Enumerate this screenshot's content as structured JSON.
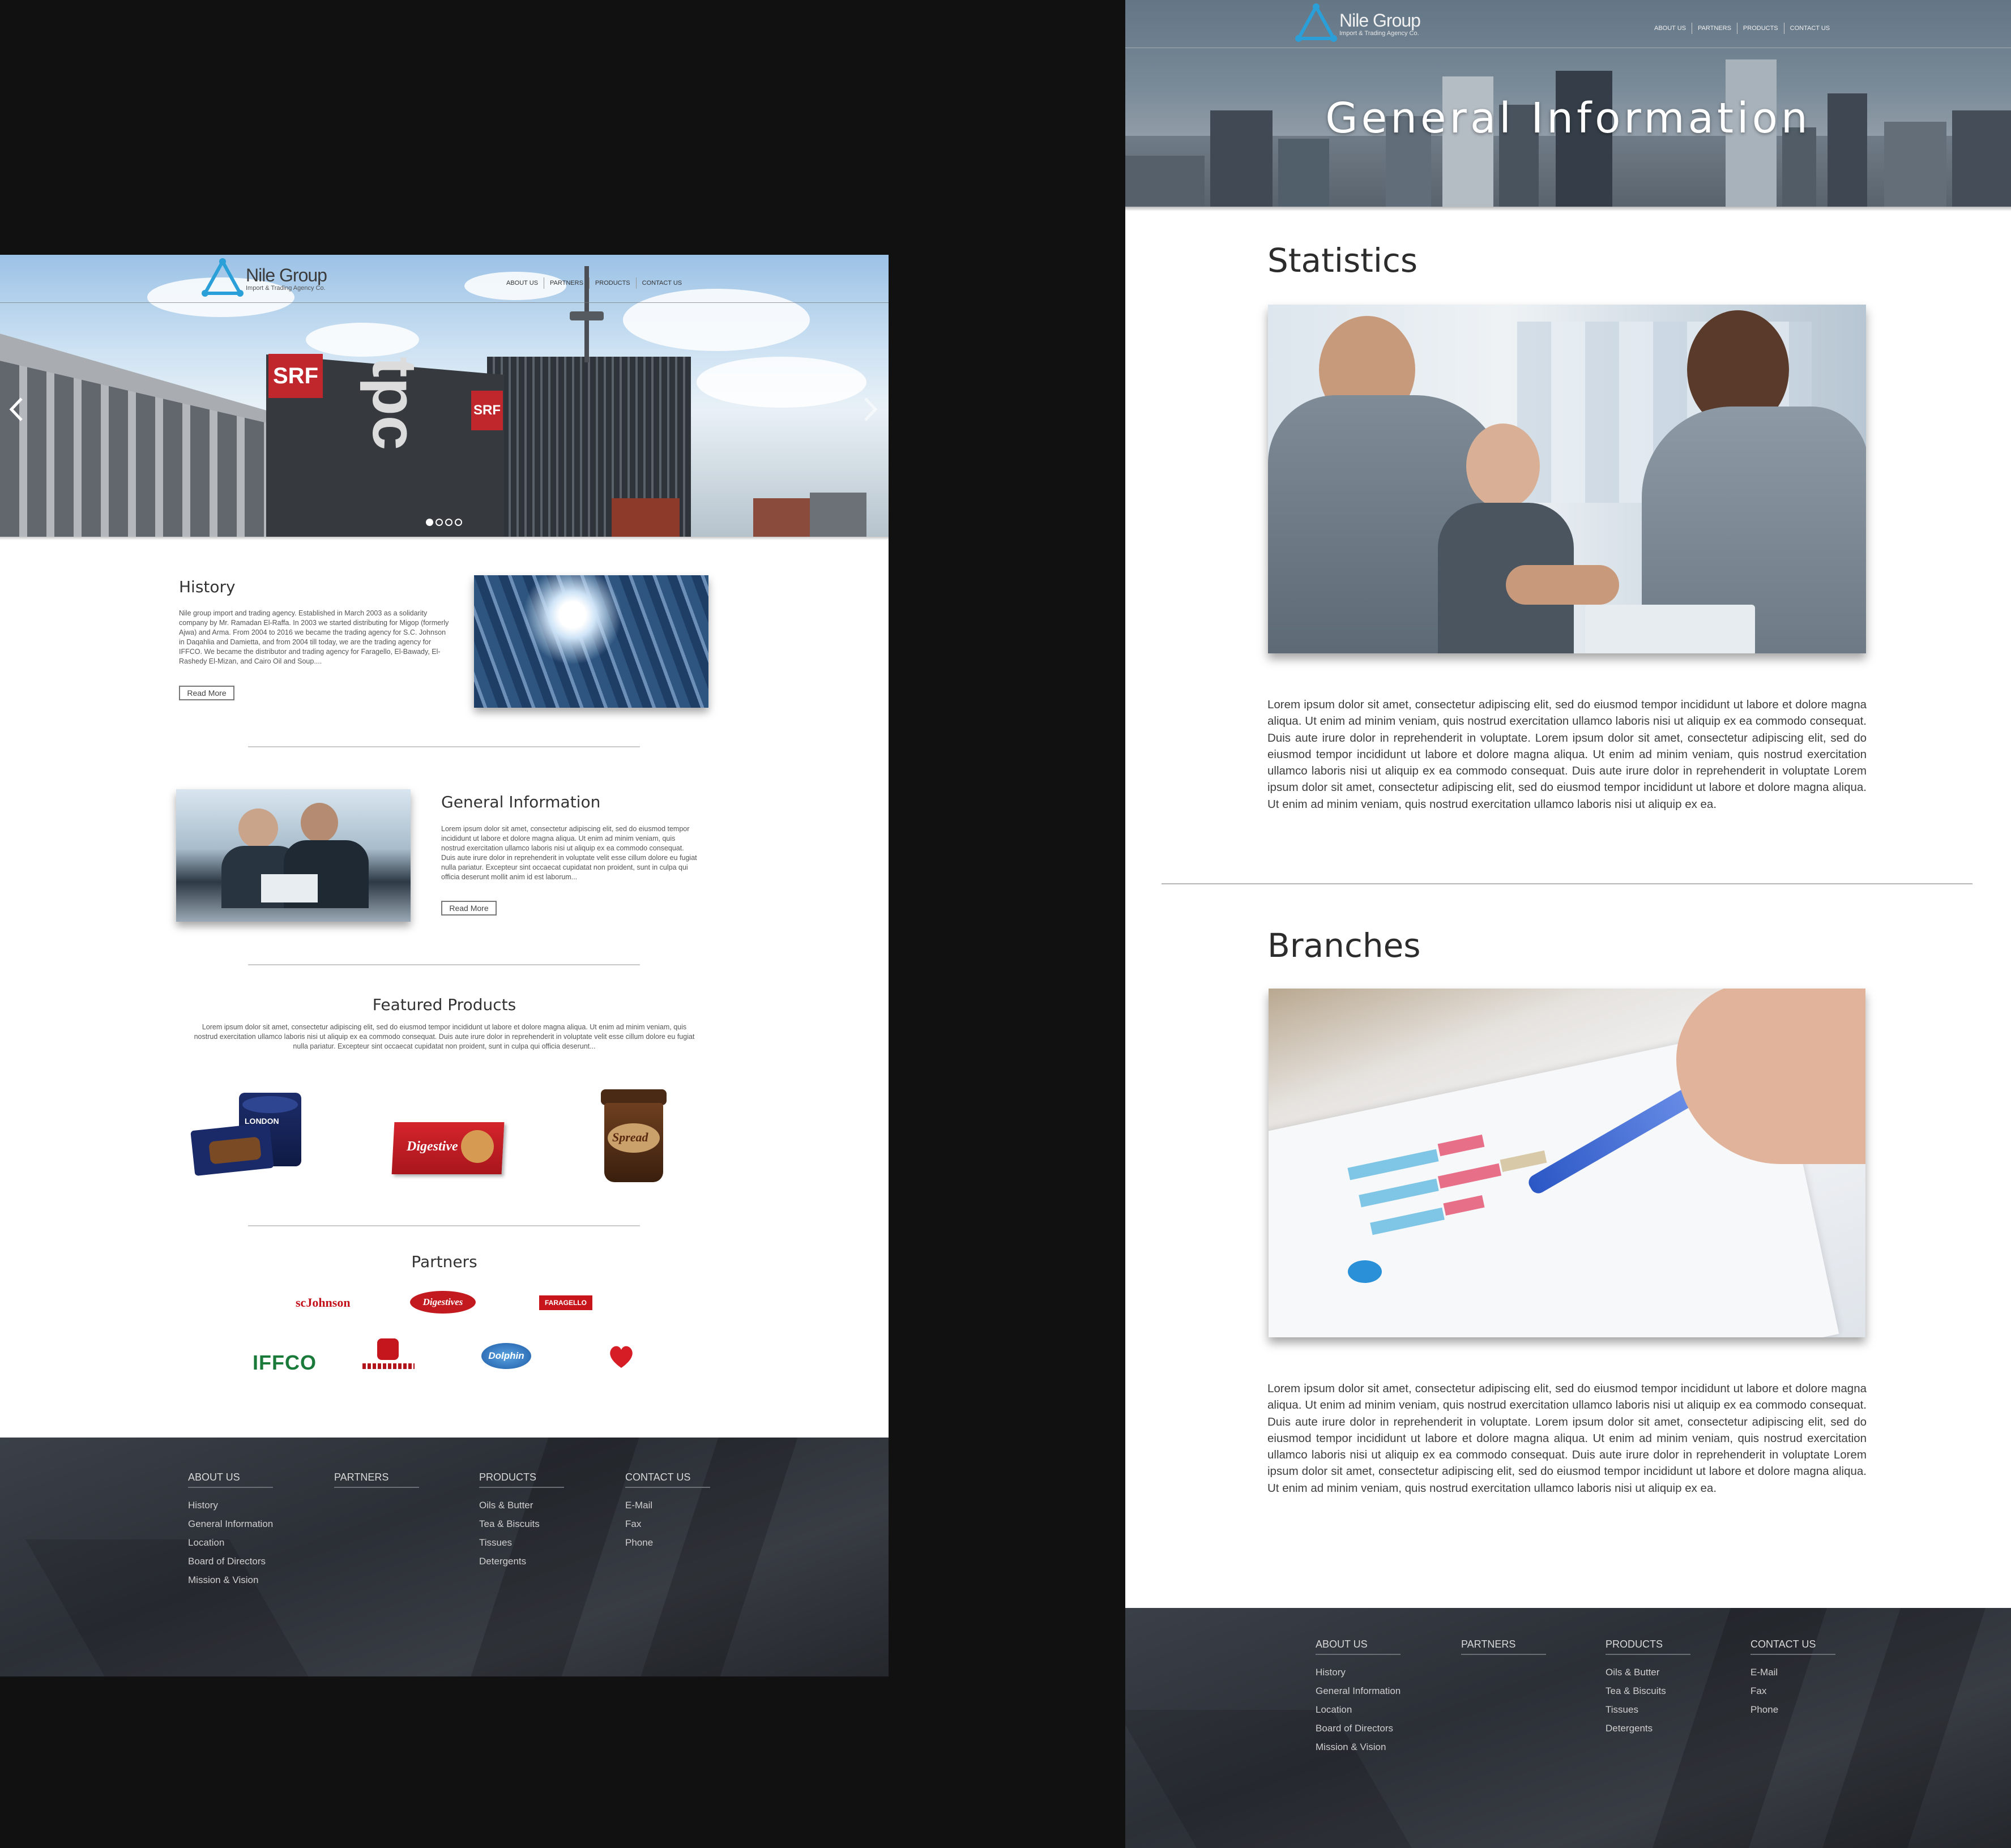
{
  "left_page": {
    "logo": {
      "title": "Nile Group",
      "subtitle": "Import & Trading Agency Co."
    },
    "nav": [
      "ABOUT US",
      "PARTNERS",
      "PRODUCTS",
      "CONTACT US"
    ],
    "hero_sign_srf": "SRF",
    "hero_sign_tpc": "tpc",
    "history": {
      "title": "History",
      "text": "Nile group import and trading agency. Established in March 2003 as a solidarity company by Mr. Ramadan El-Raffa. In 2003 we started distributing for Migop (formerly Ajwa) and Arma. From 2004 to 2016 we became the trading agency for S.C. Johnson in Daqahlia and Damietta, and from 2004 till today, we are the trading agency for IFFCO. We became the distributor and trading agency for Faragello, El-Bawady, El-Rashedy El-Mizan, and Cairo Oil and Soup....",
      "button": "Read More"
    },
    "general": {
      "title": "General Information",
      "text": "Lorem ipsum dolor sit amet, consectetur adipiscing elit, sed do eiusmod tempor incididunt ut labore et dolore magna aliqua. Ut enim ad minim veniam, quis nostrud exercitation ullamco laboris nisi ut aliquip ex ea commodo consequat. Duis aute irure dolor in reprehenderit in voluptate velit esse cillum dolore eu fugiat nulla pariatur. Excepteur sint occaecat cupidatat non proident, sunt in culpa qui officia deserunt mollit anim id est laborum...",
      "button": "Read More"
    },
    "featured": {
      "title": "Featured Products",
      "text": "Lorem ipsum dolor sit amet, consectetur adipiscing elit, sed do eiusmod tempor incididunt ut labore et dolore magna aliqua. Ut enim ad minim veniam, quis nostrud exercitation ullamco laboris nisi ut aliquip ex ea commodo consequat. Duis aute irure dolor in reprehenderit in voluptate velit esse cillum dolore eu fugiat nulla pariatur. Excepteur sint occaecat cupidatat non proident, sunt in culpa qui officia deserunt...",
      "products": [
        {
          "label": "LONDON",
          "name": "ice-cream-product"
        },
        {
          "label": "Digestive",
          "name": "digestive-biscuits-product"
        },
        {
          "label": "Spread",
          "name": "chocolate-spread-product"
        }
      ]
    },
    "partners": {
      "title": "Partners",
      "logos": [
        "scJohnson",
        "Digestives",
        "FARAGELLO",
        "IFFCO",
        "",
        "Dolphin",
        "Red Cool"
      ]
    }
  },
  "footer": {
    "columns": [
      {
        "head": "ABOUT US",
        "items": [
          "History",
          "General Information",
          "Location",
          "Board of Directors",
          "Mission & Vision"
        ]
      },
      {
        "head": "PARTNERS",
        "items": []
      },
      {
        "head": "PRODUCTS",
        "items": [
          "Oils & Butter",
          "Tea & Biscuits",
          "Tissues",
          "Detergents"
        ]
      },
      {
        "head": "CONTACT US",
        "items": [
          "E-Mail",
          "Fax",
          "Phone"
        ]
      }
    ]
  },
  "right_page": {
    "logo": {
      "title": "Nile Group",
      "subtitle": "Import & Trading Agency Co."
    },
    "nav": [
      "ABOUT US",
      "PARTNERS",
      "PRODUCTS",
      "CONTACT US"
    ],
    "hero_title": "General Information",
    "statistics": {
      "title": "Statistics",
      "text": "Lorem ipsum dolor sit amet, consectetur adipiscing elit, sed do eiusmod tempor incididunt ut labore et dolore magna aliqua. Ut enim ad minim veniam, quis nostrud exercitation ullamco laboris nisi ut aliquip ex ea commodo consequat. Duis aute irure dolor in reprehenderit in voluptate. Lorem ipsum dolor sit amet, consectetur adipiscing elit, sed do eiusmod tempor incididunt ut labore et dolore magna aliqua. Ut enim ad minim veniam, quis nostrud exercitation ullamco laboris nisi ut aliquip ex ea commodo consequat. Duis aute irure dolor in reprehenderit in voluptate Lorem ipsum dolor sit amet, consectetur adipiscing elit, sed do eiusmod tempor incididunt ut labore et dolore magna aliqua. Ut enim ad minim veniam, quis nostrud exercitation ullamco laboris nisi ut aliquip ex ea."
    },
    "branches": {
      "title": "Branches",
      "text": "Lorem ipsum dolor sit amet, consectetur adipiscing elit, sed do eiusmod tempor incididunt ut labore et dolore magna aliqua. Ut enim ad minim veniam, quis nostrud exercitation ullamco laboris nisi ut aliquip ex ea commodo consequat. Duis aute irure dolor in reprehenderit in voluptate. Lorem ipsum dolor sit amet, consectetur adipiscing elit, sed do eiusmod tempor incididunt ut labore et dolore magna aliqua. Ut enim ad minim veniam, quis nostrud exercitation ullamco laboris nisi ut aliquip ex ea commodo consequat. Duis aute irure dolor in reprehenderit in voluptate Lorem ipsum dolor sit amet, consectetur adipiscing elit, sed do eiusmod tempor incididunt ut labore et dolore magna aliqua. Ut enim ad minim veniam, quis nostrud exercitation ullamco laboris nisi ut aliquip ex ea."
    }
  },
  "colors": {
    "accent": "#2a9fd8",
    "footer": "#2f333a",
    "canvas": "#111112"
  }
}
